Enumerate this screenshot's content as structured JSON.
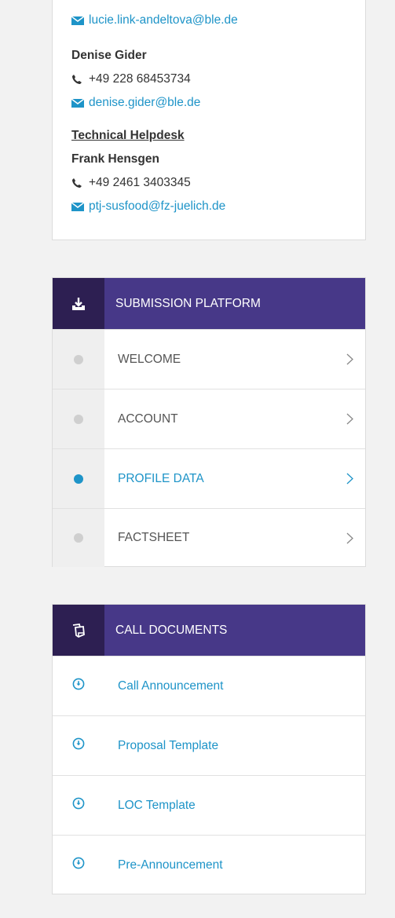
{
  "colors": {
    "accent": "#1e94c8",
    "header_dark": "#2d1f52",
    "header_purple": "#473888",
    "dot_inactive": "#cfcfcf",
    "sidebar_grey": "#efefef"
  },
  "contacts": {
    "entries": [
      {
        "email": "lucie.link-andeltova@ble.de"
      },
      {
        "name": "Denise Gider",
        "phone": "+49 228 68453734",
        "email": "denise.gider@ble.de"
      }
    ],
    "helpdesk": {
      "title": "Technical Helpdesk",
      "name": "Frank Hensgen",
      "phone": "+49 2461 3403345",
      "email": "ptj-susfood@fz-juelich.de"
    },
    "icons": {
      "email": "envelope-icon",
      "phone": "phone-icon"
    }
  },
  "submission": {
    "title": "SUBMISSION PLATFORM",
    "icon": "download-tray-icon",
    "items": [
      {
        "label": "WELCOME",
        "active": false
      },
      {
        "label": "ACCOUNT",
        "active": false
      },
      {
        "label": "PROFILE DATA",
        "active": true
      },
      {
        "label": "FACTSHEET",
        "active": false
      }
    ]
  },
  "documents": {
    "title": "CALL DOCUMENTS",
    "icon": "documents-icon",
    "items": [
      {
        "label": "Call Announcement"
      },
      {
        "label": "Proposal Template"
      },
      {
        "label": "LOC Template"
      },
      {
        "label": "Pre-Announcement"
      }
    ],
    "item_icon": "download-circle-icon"
  }
}
